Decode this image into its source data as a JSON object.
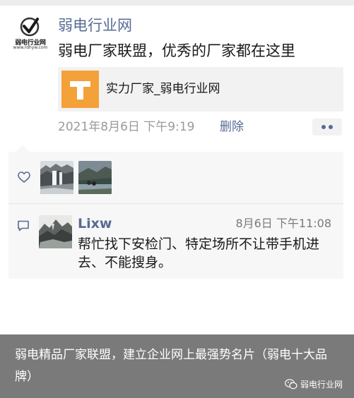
{
  "post": {
    "logo_name": "弱电行业网",
    "logo_url": "www.rdhyw.com",
    "author": "弱电行业网",
    "text": "弱电厂家联盟，优秀的厂家都在这里",
    "link_title": "实力厂家_弱电行业网",
    "time": "2021年8月6日 下午9:19",
    "delete_label": "删除"
  },
  "comment": {
    "author": "Lixw",
    "time": "8月6日 下午11:08",
    "text": "帮忙找下安检门、特定场所不让带手机进去、不能搜身。"
  },
  "caption": {
    "text": "弱电精品厂家联盟，建立企业网上最强势名片（弱电十大品牌）",
    "watermark": "弱电行业网"
  },
  "colors": {
    "link_blue": "#576b95",
    "link_thumb_orange": "#f4a13a",
    "caption_gray": "#7a7a7a"
  }
}
